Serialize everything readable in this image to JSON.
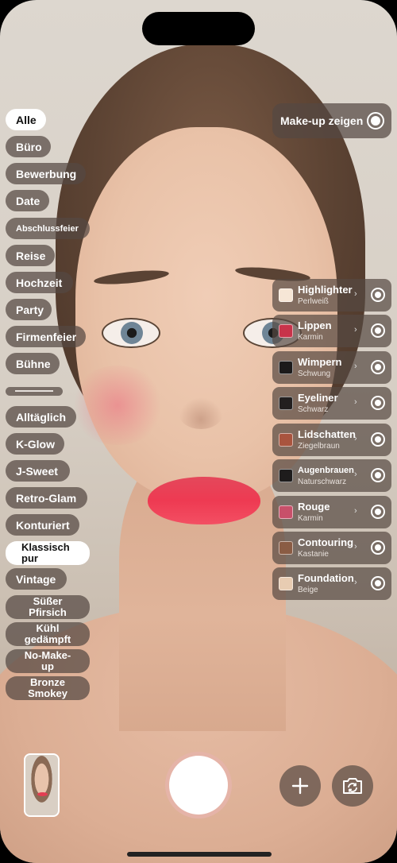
{
  "toggle": {
    "label": "Make-up zeigen",
    "on": true
  },
  "chips": [
    {
      "label": "Alle",
      "active": true
    },
    {
      "label": "Büro"
    },
    {
      "label": "Bewerbung"
    },
    {
      "label": "Date"
    },
    {
      "label": "Abschlussfeier"
    },
    {
      "label": "Reise"
    },
    {
      "label": "Hochzeit"
    },
    {
      "label": "Party"
    },
    {
      "label": "Firmenfeier"
    },
    {
      "label": "Bühne"
    },
    {
      "label": "Alltäglich"
    },
    {
      "label": "K-Glow"
    },
    {
      "label": "J-Sweet"
    },
    {
      "label": "Retro-Glam"
    },
    {
      "label": "Konturiert"
    },
    {
      "label": "Klassisch pur"
    },
    {
      "label": "Vintage"
    },
    {
      "label": "Süßer Pfirsich"
    },
    {
      "label": "Kühl gedämpft"
    },
    {
      "label": "No-Make-up"
    },
    {
      "label": "Bronze Smokey"
    }
  ],
  "products": [
    {
      "name": "Highlighter",
      "shade": "Perlweiß",
      "color": "#f6e6d6"
    },
    {
      "name": "Lippen",
      "shade": "Karmin",
      "color": "#c8334a"
    },
    {
      "name": "Wimpern",
      "shade": "Schwung",
      "color": "#1c1a1a"
    },
    {
      "name": "Eyeliner",
      "shade": "Schwarz",
      "color": "#221f1f"
    },
    {
      "name": "Lidschatten",
      "shade": "Ziegelbraun",
      "color": "#a9543e"
    },
    {
      "name": "Augenbrauen",
      "shade": "Naturschwarz",
      "color": "#1e1c1c"
    },
    {
      "name": "Rouge",
      "shade": "Karmin",
      "color": "#c8506a"
    },
    {
      "name": "Contouring",
      "shade": "Kastanie",
      "color": "#8a5c44"
    },
    {
      "name": "Foundation",
      "shade": "Beige",
      "color": "#e8ccb2"
    }
  ],
  "icons": {
    "chevron": "chevron-right-icon",
    "add": "plus-icon",
    "camera_flip": "camera-rotate-icon"
  }
}
